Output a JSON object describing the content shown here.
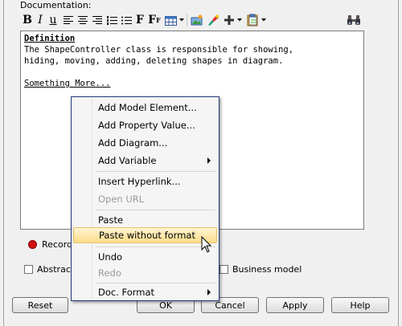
{
  "documentation_label": "Documentation:",
  "toolbar": {
    "bold": "B",
    "italic": "I",
    "underline": "u",
    "font": "F",
    "font_size": "F"
  },
  "editor": {
    "heading": "Definition",
    "line1": "The ShapeController class is responsible for showing,",
    "line2": "hiding, moving, adding, deleting shapes in diagram.",
    "line3": "Something More..."
  },
  "record_label": "Record",
  "checkboxes": {
    "abstract": "Abstract",
    "business_model": "Business model"
  },
  "buttons": {
    "reset": "Reset",
    "ok": "OK",
    "cancel": "Cancel",
    "apply": "Apply",
    "help": "Help"
  },
  "context_menu": {
    "items": [
      {
        "label": "Add Model Element...",
        "enabled": true
      },
      {
        "label": "Add Property Value...",
        "enabled": true
      },
      {
        "label": "Add Diagram...",
        "enabled": true
      },
      {
        "label": "Add Variable",
        "enabled": true,
        "submenu": true
      },
      {
        "label": "Insert Hyperlink...",
        "enabled": true
      },
      {
        "label": "Open URL",
        "enabled": false
      },
      {
        "label": "Paste",
        "enabled": true
      },
      {
        "label": "Paste without format",
        "enabled": true,
        "highlighted": true
      },
      {
        "label": "Undo",
        "enabled": true
      },
      {
        "label": "Redo",
        "enabled": false
      },
      {
        "label": "Doc. Format",
        "enabled": true,
        "submenu": true
      }
    ]
  },
  "colors": {
    "menu_border": "#1f3a70",
    "highlight": "#fddd8a",
    "record_dot": "#d01010"
  }
}
